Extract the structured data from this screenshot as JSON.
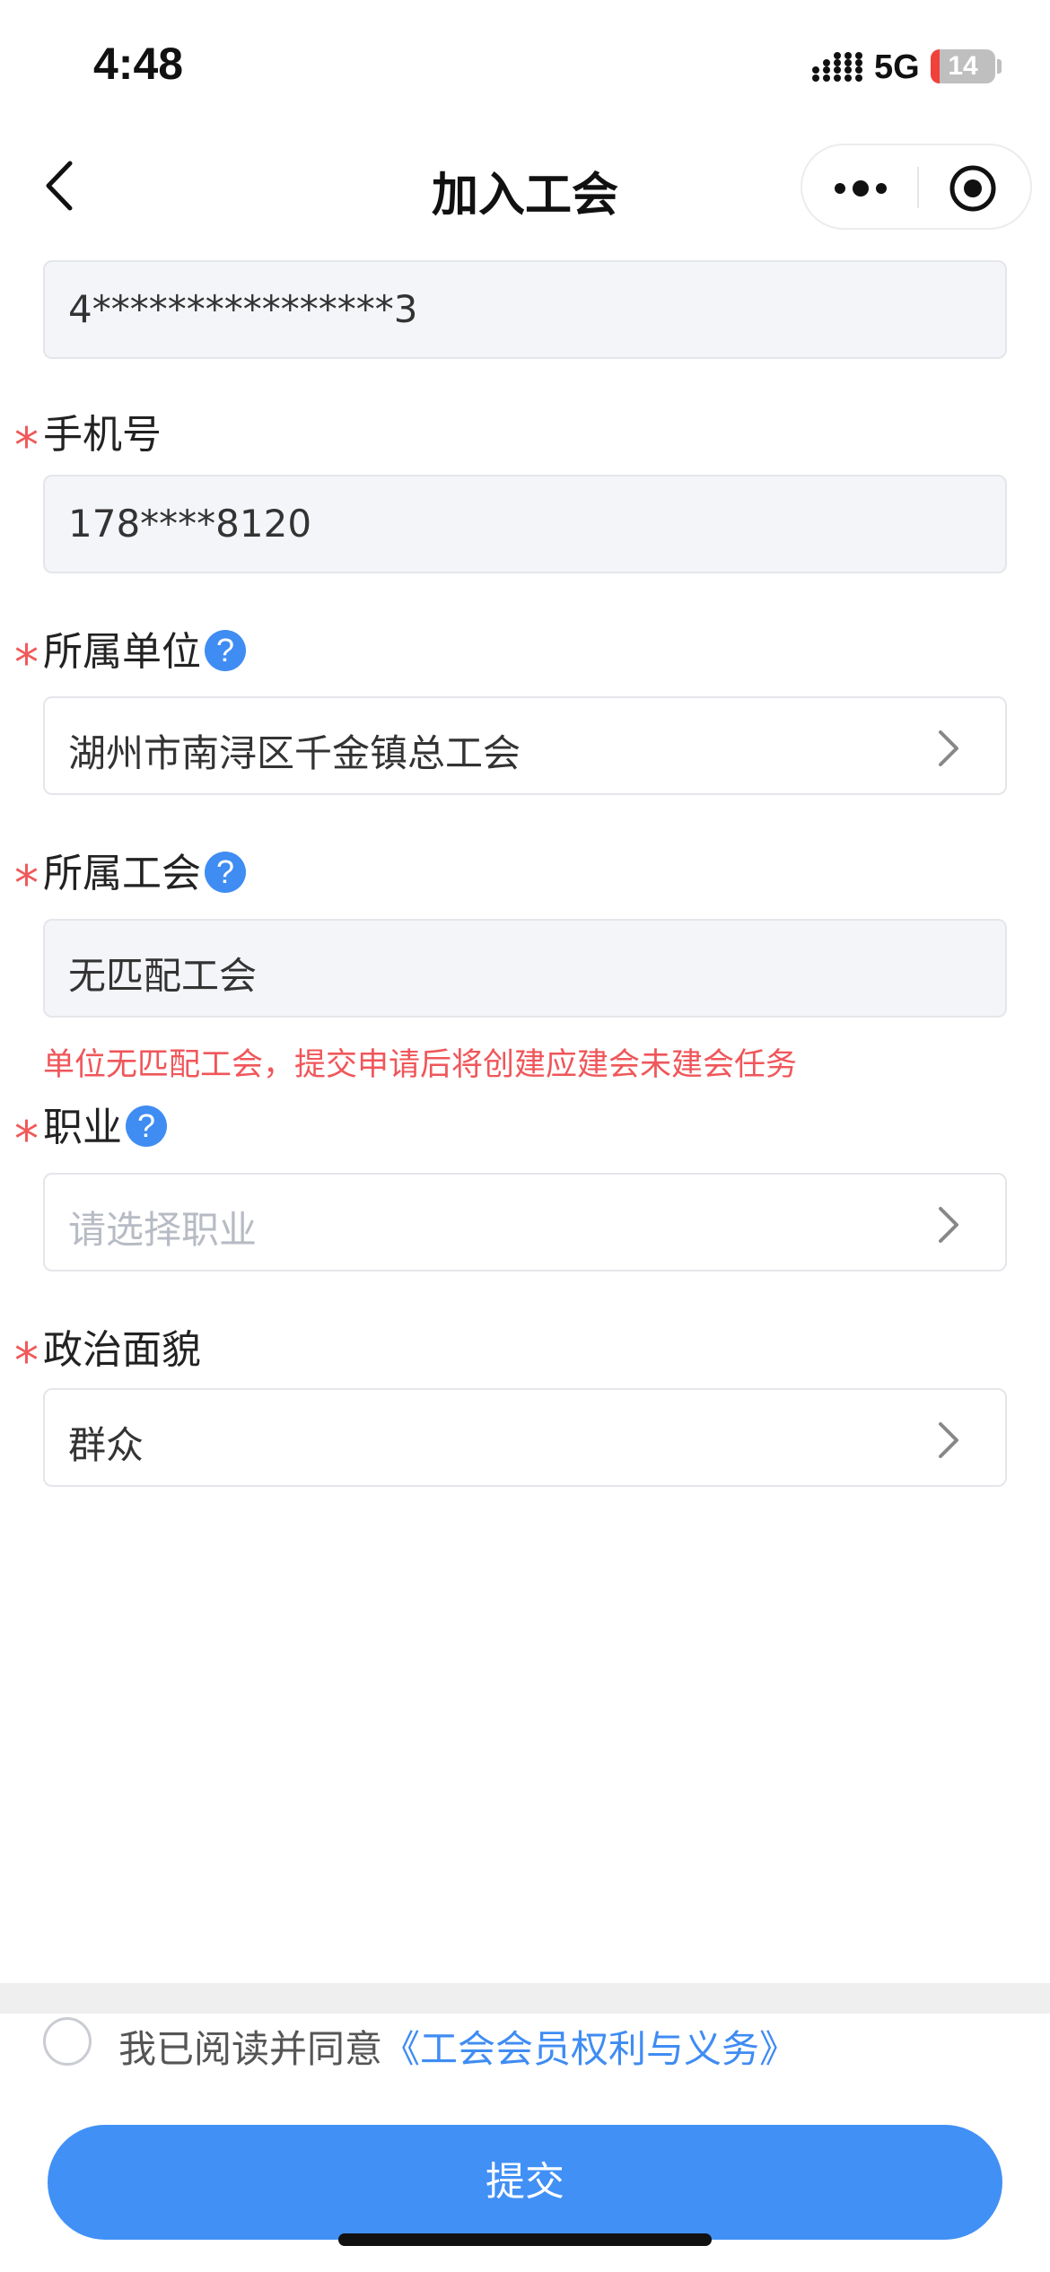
{
  "status_bar": {
    "time": "4:48",
    "network": "5G",
    "battery": "14",
    "battery_level": 0.14,
    "battery_color": "#f0413b"
  },
  "nav": {
    "title": "加入工会",
    "icons": {
      "back": "chevron-left-icon",
      "more": "more-dots-icon",
      "close": "target-circle-icon"
    }
  },
  "form": {
    "id_number": {
      "value": "4****************3"
    },
    "phone": {
      "label": "手机号",
      "value": "178****8120"
    },
    "unit": {
      "label": "所属单位",
      "value": "湖州市南浔区千金镇总工会"
    },
    "union": {
      "label": "所属工会",
      "value": "无匹配工会",
      "warning": "单位无匹配工会，提交申请后将创建应建会未建会任务"
    },
    "occupation": {
      "label": "职业",
      "placeholder": "请选择职业"
    },
    "political": {
      "label": "政治面貌",
      "value": "群众"
    },
    "required_mark": "*",
    "help_glyph": "?"
  },
  "agreement": {
    "prefix": "我已阅读并同意",
    "link": "《工会会员权利与义务》",
    "checked": false
  },
  "submit": {
    "label": "提交"
  },
  "colors": {
    "accent": "#4190f6",
    "required": "#f05a5a",
    "warning": "#f0565a",
    "readonly_bg": "#f4f5f8"
  }
}
